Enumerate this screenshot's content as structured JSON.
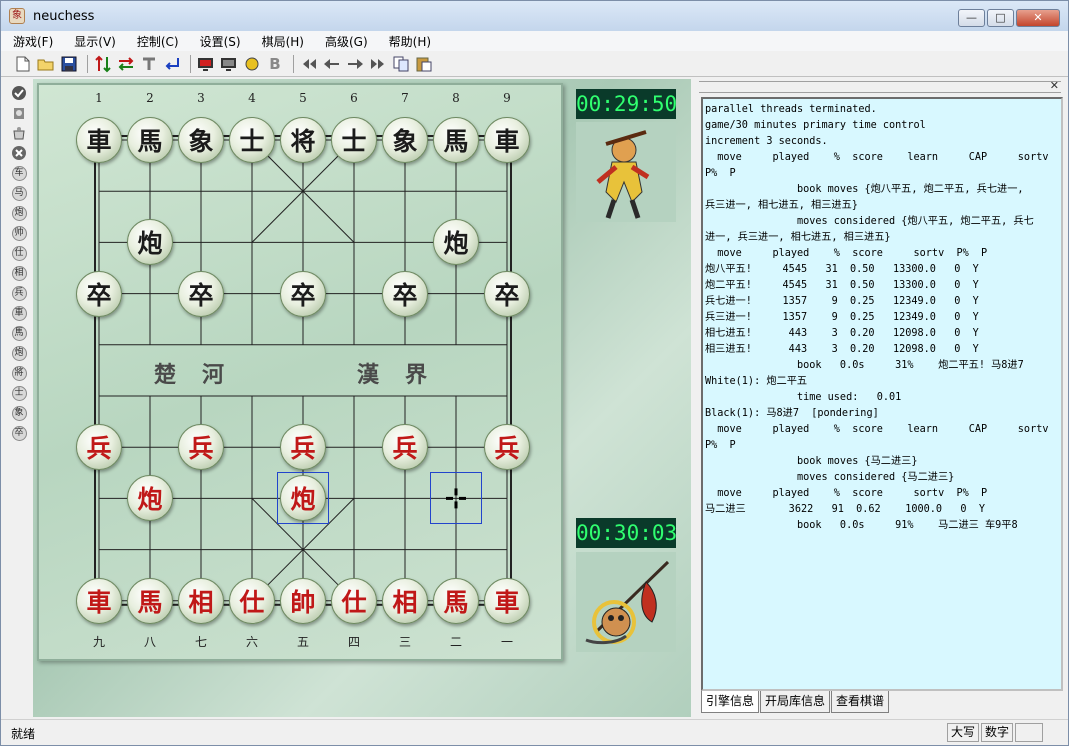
{
  "window": {
    "title": "neuchess",
    "icon": "chess-app-icon"
  },
  "window_controls": {
    "minimize": "—",
    "maximize": "□",
    "close": "✕"
  },
  "menu": [
    "游戏(F)",
    "显示(V)",
    "控制(C)",
    "设置(S)",
    "棋局(H)",
    "高级(G)",
    "帮助(H)"
  ],
  "toolbar": [
    "new-icon",
    "open-icon",
    "save-icon",
    "flip-icon",
    "swap-icon",
    "hint-icon",
    "undo-arrow-icon",
    "red-flag-icon",
    "monitor-icon",
    "ball-icon",
    "bold-icon",
    "first-icon",
    "back-icon",
    "forward-icon",
    "last-icon",
    "copy-icon",
    "paste-icon"
  ],
  "sidebar": [
    "check-icon",
    "pawn-pin-icon",
    "pot-icon",
    "delete-icon",
    "车",
    "马",
    "炮",
    "帅",
    "仕",
    "相",
    "兵",
    "車",
    "馬",
    "炮",
    "將",
    "士",
    "象",
    "卒"
  ],
  "board": {
    "top_numbers": [
      "1",
      "2",
      "3",
      "4",
      "5",
      "6",
      "7",
      "8",
      "9"
    ],
    "bottom_numbers": [
      "九",
      "八",
      "七",
      "六",
      "五",
      "四",
      "三",
      "二",
      "一"
    ],
    "river_left": "楚　河",
    "river_right": "漢　界",
    "pieces": [
      {
        "ch": "車",
        "side": "black",
        "col": 0,
        "row": 0
      },
      {
        "ch": "馬",
        "side": "black",
        "col": 1,
        "row": 0
      },
      {
        "ch": "象",
        "side": "black",
        "col": 2,
        "row": 0
      },
      {
        "ch": "士",
        "side": "black",
        "col": 3,
        "row": 0
      },
      {
        "ch": "将",
        "side": "black",
        "col": 4,
        "row": 0
      },
      {
        "ch": "士",
        "side": "black",
        "col": 5,
        "row": 0
      },
      {
        "ch": "象",
        "side": "black",
        "col": 6,
        "row": 0
      },
      {
        "ch": "馬",
        "side": "black",
        "col": 7,
        "row": 0
      },
      {
        "ch": "車",
        "side": "black",
        "col": 8,
        "row": 0
      },
      {
        "ch": "炮",
        "side": "black",
        "col": 1,
        "row": 2
      },
      {
        "ch": "炮",
        "side": "black",
        "col": 7,
        "row": 2
      },
      {
        "ch": "卒",
        "side": "black",
        "col": 0,
        "row": 3
      },
      {
        "ch": "卒",
        "side": "black",
        "col": 2,
        "row": 3
      },
      {
        "ch": "卒",
        "side": "black",
        "col": 4,
        "row": 3
      },
      {
        "ch": "卒",
        "side": "black",
        "col": 6,
        "row": 3
      },
      {
        "ch": "卒",
        "side": "black",
        "col": 8,
        "row": 3
      },
      {
        "ch": "兵",
        "side": "red",
        "col": 0,
        "row": 6
      },
      {
        "ch": "兵",
        "side": "red",
        "col": 2,
        "row": 6
      },
      {
        "ch": "兵",
        "side": "red",
        "col": 4,
        "row": 6
      },
      {
        "ch": "兵",
        "side": "red",
        "col": 6,
        "row": 6
      },
      {
        "ch": "兵",
        "side": "red",
        "col": 8,
        "row": 6
      },
      {
        "ch": "炮",
        "side": "red",
        "col": 1,
        "row": 7
      },
      {
        "ch": "炮",
        "side": "red",
        "col": 4,
        "row": 7
      },
      {
        "ch": "車",
        "side": "red",
        "col": 0,
        "row": 9
      },
      {
        "ch": "馬",
        "side": "red",
        "col": 1,
        "row": 9
      },
      {
        "ch": "相",
        "side": "red",
        "col": 2,
        "row": 9
      },
      {
        "ch": "仕",
        "side": "red",
        "col": 3,
        "row": 9
      },
      {
        "ch": "帥",
        "side": "red",
        "col": 4,
        "row": 9
      },
      {
        "ch": "仕",
        "side": "red",
        "col": 5,
        "row": 9
      },
      {
        "ch": "相",
        "side": "red",
        "col": 6,
        "row": 9
      },
      {
        "ch": "馬",
        "side": "red",
        "col": 7,
        "row": 9
      },
      {
        "ch": "車",
        "side": "red",
        "col": 8,
        "row": 9
      }
    ],
    "highlights": [
      {
        "col": 4,
        "row": 7
      },
      {
        "col": 7,
        "row": 7
      }
    ]
  },
  "clocks": {
    "top": "00:29:50",
    "bottom": "00:30:03"
  },
  "log_lines": [
    "parallel threads terminated.",
    "game/30 minutes primary time control",
    "increment 3 seconds.",
    "  move     played    %  score    learn     CAP     sortv",
    "P%  P",
    "               book moves {炮八平五, 炮二平五, 兵七进一,",
    "兵三进一, 相七进五, 相三进五}",
    "               moves considered {炮八平五, 炮二平五, 兵七",
    "进一, 兵三进一, 相七进五, 相三进五}",
    "  move     played    %  score     sortv  P%  P",
    "炮八平五!     4545   31  0.50   13300.0   0  Y",
    "炮二平五!     4545   31  0.50   13300.0   0  Y",
    "兵七进一!     1357    9  0.25   12349.0   0  Y",
    "兵三进一!     1357    9  0.25   12349.0   0  Y",
    "相七进五!      443    3  0.20   12098.0   0  Y",
    "相三进五!      443    3  0.20   12098.0   0  Y",
    "               book   0.0s     31%    炮二平五! 马8进7",
    "White(1): 炮二平五",
    "               time used:   0.01",
    "Black(1): 马8进7  [pondering]",
    "  move     played    %  score    learn     CAP     sortv",
    "P%  P",
    "               book moves {马二进三}",
    "               moves considered {马二进三}",
    "  move     played    %  score     sortv  P%  P",
    "马二进三       3622   91  0.62    1000.0   0  Y",
    "               book   0.0s     91%    马二进三 车9平8"
  ],
  "tabs": [
    "引擎信息",
    "开局库信息",
    "查看棋谱"
  ],
  "status": {
    "text": "就绪",
    "caps": "大写",
    "num": "数字"
  }
}
